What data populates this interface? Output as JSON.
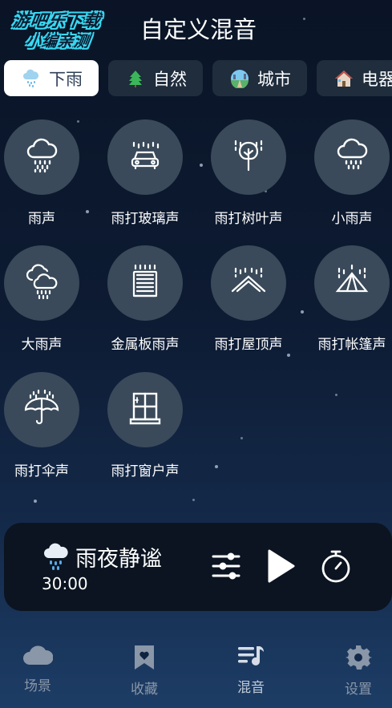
{
  "logo": {
    "line1": "游吧乐下载",
    "line2": "小编亲测"
  },
  "header": {
    "title": "自定义混音"
  },
  "tabs": [
    {
      "label": "下雨",
      "icon": "rain-cloud-icon",
      "active": true
    },
    {
      "label": "自然",
      "icon": "pine-tree-icon",
      "active": false
    },
    {
      "label": "城市",
      "icon": "city-globe-icon",
      "active": false
    },
    {
      "label": "电器",
      "icon": "house-icon",
      "active": false
    }
  ],
  "sounds": [
    {
      "label": "雨声",
      "icon": "rain-cloud-icon"
    },
    {
      "label": "雨打玻璃声",
      "icon": "car-rain-icon"
    },
    {
      "label": "雨打树叶声",
      "icon": "tree-rain-icon"
    },
    {
      "label": "小雨声",
      "icon": "light-rain-cloud-icon"
    },
    {
      "label": "大雨声",
      "icon": "heavy-rain-cloud-icon"
    },
    {
      "label": "金属板雨声",
      "icon": "metal-shutter-icon"
    },
    {
      "label": "雨打屋顶声",
      "icon": "roof-rain-icon"
    },
    {
      "label": "雨打帐篷声",
      "icon": "tent-rain-icon"
    },
    {
      "label": "雨打伞声",
      "icon": "umbrella-rain-icon"
    },
    {
      "label": "雨打窗户声",
      "icon": "window-icon"
    }
  ],
  "player": {
    "name": "雨夜静谧",
    "time": "30:00"
  },
  "nav": [
    {
      "label": "场景",
      "icon": "cloud-icon"
    },
    {
      "label": "收藏",
      "icon": "bookmark-heart-icon"
    },
    {
      "label": "混音",
      "icon": "music-mix-icon",
      "active": true
    },
    {
      "label": "设置",
      "icon": "gear-icon"
    }
  ],
  "colors": {
    "accent_tab_bg": "#ffffff",
    "tab_bg": "#1f2d3d",
    "circle_bg": "#3a4a5a",
    "player_bg": "#0b1420"
  }
}
